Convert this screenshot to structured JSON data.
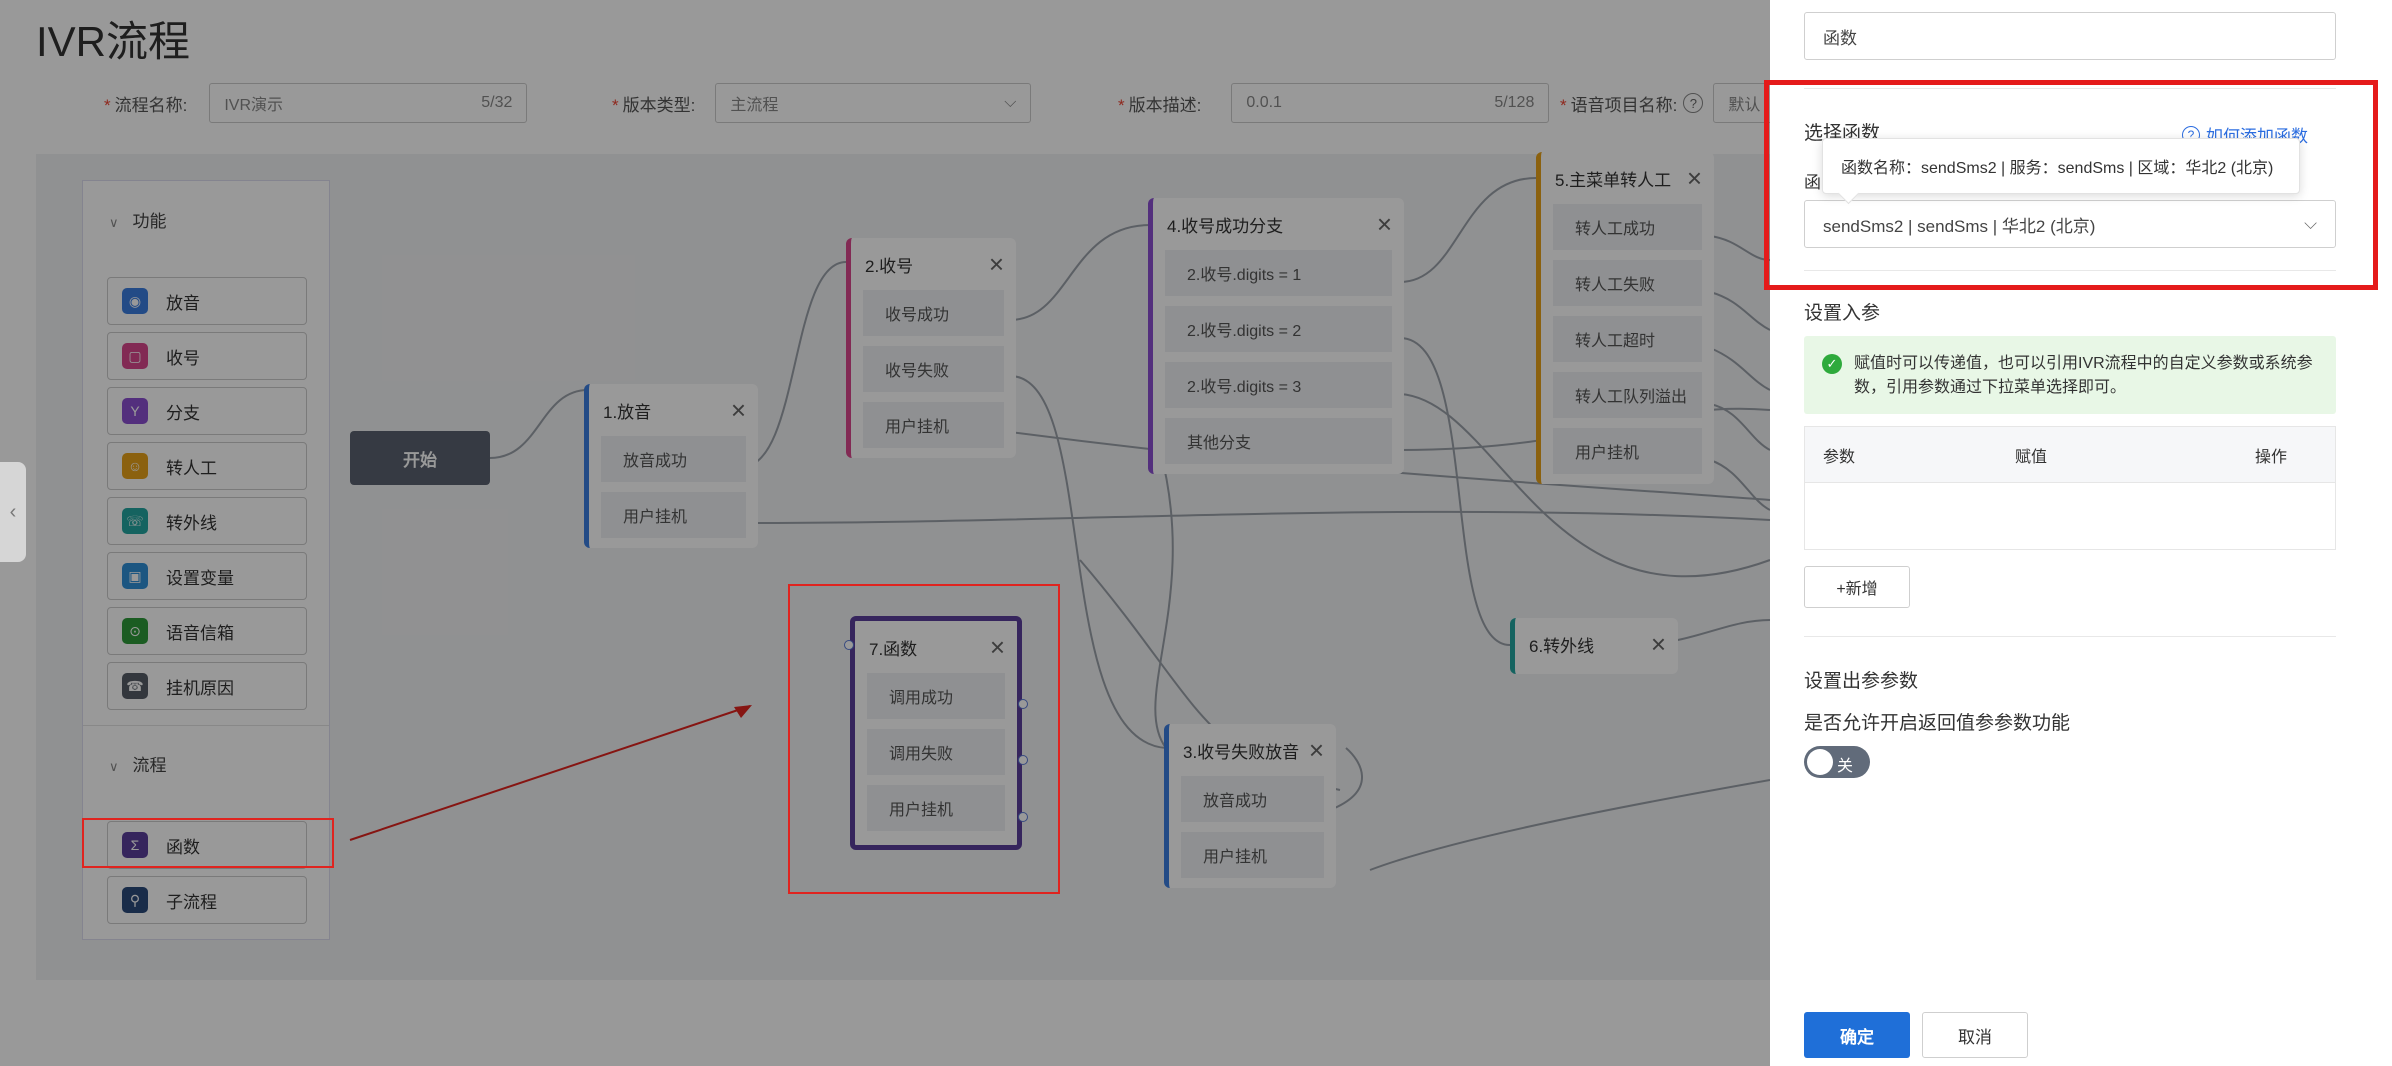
{
  "page": {
    "title": "IVR流程",
    "fields": {
      "flow_name_label": "流程名称:",
      "flow_name_value": "IVR演示",
      "flow_name_count": "5/32",
      "version_type_label": "版本类型:",
      "version_type_value": "主流程",
      "version_desc_label": "版本描述:",
      "version_desc_value": "0.0.1",
      "version_desc_count": "5/128",
      "voice_project_label": "语音项目名称:",
      "voice_project_value": "默认"
    }
  },
  "palette": {
    "section_function": "功能",
    "section_flow": "流程",
    "function_items": [
      "放音",
      "收号",
      "分支",
      "转人工",
      "转外线",
      "设置变量",
      "语音信箱",
      "挂机原因"
    ],
    "flow_items": [
      "函数",
      "子流程"
    ]
  },
  "canvas": {
    "start": "开始",
    "nodes": {
      "n1": {
        "title": "1.放音",
        "ports": [
          "放音成功",
          "用户挂机"
        ]
      },
      "n2": {
        "title": "2.收号",
        "ports": [
          "收号成功",
          "收号失败",
          "用户挂机"
        ]
      },
      "n3": {
        "title": "3.收号失败放音",
        "ports": [
          "放音成功",
          "用户挂机"
        ]
      },
      "n4": {
        "title": "4.收号成功分支",
        "ports": [
          "2.收号.digits = 1",
          "2.收号.digits = 2",
          "2.收号.digits = 3",
          "其他分支"
        ]
      },
      "n5": {
        "title": "5.主菜单转人工",
        "ports": [
          "转人工成功",
          "转人工失败",
          "转人工超时",
          "转人工队列溢出",
          "用户挂机"
        ]
      },
      "n6": {
        "title": "6.转外线",
        "ports": []
      },
      "n7": {
        "title": "7.函数",
        "ports": [
          "调用成功",
          "调用失败",
          "用户挂机"
        ]
      }
    }
  },
  "drawer": {
    "name_value": "函数",
    "select_function_label": "选择函数",
    "add_function_link": "如何添加函数",
    "function_label_partial": "函",
    "tooltip": "函数名称：sendSms2 | 服务：sendSms | 区域：华北2 (北京)",
    "selected_function": "sendSms2 | sendSms | 华北2 (北京)",
    "set_input_params": "设置入参",
    "info_text": "赋值时可以传递值，也可以引用IVR流程中的自定义参数或系统参数，引用参数通过下拉菜单选择即可。",
    "table_headers": [
      "参数",
      "赋值",
      "操作"
    ],
    "add_button": "+新增",
    "set_output_params": "设置出参参数",
    "allow_return": "是否允许开启返回值参参数功能",
    "toggle_label": "关",
    "ok_button": "确定",
    "cancel_button": "取消"
  },
  "colors": {
    "play": "#3b7de0",
    "collect": "#d9468c",
    "branch": "#8a4fd1",
    "transfer": "#e8a21a",
    "external": "#23a6a0",
    "function": "#5b3f9c",
    "primary": "#1f6fd8",
    "annotation": "#e51b1b"
  }
}
